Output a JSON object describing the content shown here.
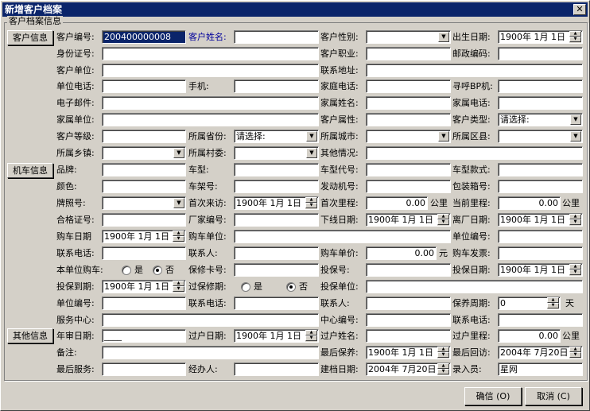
{
  "window": {
    "title": "新增客户档案",
    "close_glyph": "✕",
    "group_title": "客户档案信息"
  },
  "sections": {
    "customer": "客户信息",
    "vehicle": "机车信息",
    "other": "其他信息"
  },
  "labels": {
    "cust_no": "客户编号:",
    "cust_name": "客户姓名:",
    "cust_gender": "客户性别:",
    "birth_date": "出生日期:",
    "id_no": "身份证号:",
    "occupation": "客户职业:",
    "postcode": "邮政编码:",
    "cust_unit": "客户单位:",
    "address": "联系地址:",
    "unit_phone": "单位电话:",
    "mobile": "手机:",
    "home_phone": "家庭电话:",
    "pager": "寻呼BP机:",
    "email": "电子邮件:",
    "family_name": "家属姓名:",
    "family_phone": "家属电话:",
    "family_unit": "家属单位:",
    "cust_attr": "客户属性:",
    "cust_type": "客户类型:",
    "cust_level": "客户等级:",
    "province": "所属省份:",
    "city": "所属城市:",
    "district": "所属区县:",
    "town": "所属乡镇:",
    "village": "所属村委:",
    "other_info": "其他情况:",
    "brand": "品牌:",
    "model": "车型:",
    "model_code": "车型代号:",
    "model_style": "车型款式:",
    "color": "颜色:",
    "frame_no": "车架号:",
    "engine_no": "发动机号:",
    "box_no": "包装箱号:",
    "plate_no": "牌照号:",
    "first_visit": "首次来访:",
    "first_mileage": "首次里程:",
    "cur_mileage": "当前里程:",
    "cert_no": "合格证号:",
    "factory_no": "厂家编号:",
    "offline_date": "下线日期:",
    "exfactory_date": "离厂日期:",
    "purchase_date": "购车日期",
    "purchase_unit": "购车单位:",
    "unit_no": "单位编号:",
    "contact_phone": "联系电话:",
    "contact_person": "联系人:",
    "unit_price": "购车单价:",
    "invoice": "购车发票:",
    "unit_purchase": "本单位购车:",
    "warranty_card": "保修卡号:",
    "warranty_no": "投保号:",
    "insure_date": "投保日期:",
    "insure_expire": "投保到期:",
    "warranty_expired": "过保修期:",
    "insure_unit": "投保单位:",
    "unit_no2": "单位编号:",
    "contact_phone2": "联系电话:",
    "contact_person2": "联系人:",
    "maint_cycle": "保养周期:",
    "service_center": "服务中心:",
    "center_no": "中心编号:",
    "contact_phone3": "联系电话:",
    "annual_review": "年审日期:",
    "transfer_date": "过户日期:",
    "transfer_name": "过户姓名:",
    "transfer_mileage": "过户里程:",
    "remark": "备注:",
    "last_maint": "最后保养:",
    "last_return": "最后回访:",
    "last_service": "最后服务:",
    "handler": "经办人:",
    "create_date": "建档日期:",
    "entry_person": "录入员:"
  },
  "values": {
    "cust_no": "200400000008",
    "birth_date": "1900年 1月 1日",
    "province": "请选择:",
    "cust_type": "请选择:",
    "first_visit": "1900年 1月 1日",
    "first_mileage": "0.00",
    "cur_mileage": "0.00",
    "offline_date": "1900年 1月 1日",
    "exfactory_date": "1900年 1月 1日",
    "purchase_date": "1900年 1月 1日",
    "unit_price": "0.00",
    "insure_date": "1900年 1月 1日",
    "insure_expire": "1900年 1月 1日",
    "maint_cycle": "0",
    "annual_review": "____",
    "transfer_date": "1900年 1月 1日",
    "transfer_mileage": "0.00",
    "last_maint": "1900年 1月 1日",
    "last_return": "2004年 7月20日",
    "create_date": "2004年 7月20日",
    "entry_person": "星网"
  },
  "units": {
    "km": "公里",
    "yuan": "元",
    "day": "天"
  },
  "radios": {
    "yes": "是",
    "no": "否",
    "unit_purchase_selected": "no",
    "warranty_expired_selected": "no"
  },
  "buttons": {
    "ok": "确信 (O)",
    "cancel": "取消 (C)"
  }
}
